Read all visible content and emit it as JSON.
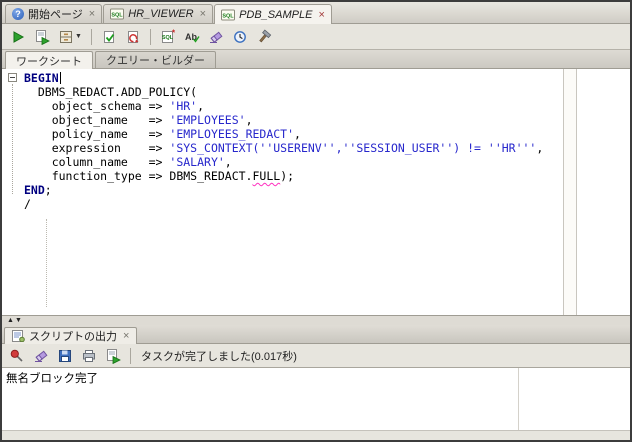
{
  "doc_tabs": [
    {
      "label": "開始ページ",
      "close": "×",
      "active": false
    },
    {
      "label": "HR_VIEWER",
      "close": "×",
      "active": false
    },
    {
      "label": "PDB_SAMPLE",
      "close": "×",
      "active": true
    }
  ],
  "icons": {
    "help_glyph": "?",
    "sql_badge": "SQL",
    "case_letters": "Ab",
    "asterisk": "*"
  },
  "main_toolbar": {
    "icon_names": [
      "run-statement",
      "run-script",
      "explain-plan",
      "commit",
      "rollback",
      "unshared-worksheet",
      "change-case",
      "clear",
      "sql-history",
      "hammer"
    ]
  },
  "worksheet_tabs": [
    {
      "label": "ワークシート",
      "active": true
    },
    {
      "label": "クエリー・ビルダー",
      "active": false
    }
  ],
  "editor": {
    "code_lines": [
      {
        "caret": true,
        "segments": [
          {
            "t": "BEGIN",
            "c": "kw"
          }
        ]
      },
      {
        "segments": [
          {
            "t": "  DBMS_REDACT.ADD_POLICY(",
            "c": "plain"
          }
        ]
      },
      {
        "segments": [
          {
            "t": "    object_schema => ",
            "c": "plain"
          },
          {
            "t": "'HR'",
            "c": "str"
          },
          {
            "t": ",",
            "c": "plain"
          }
        ]
      },
      {
        "segments": [
          {
            "t": "    object_name   => ",
            "c": "plain"
          },
          {
            "t": "'EMPLOYEES'",
            "c": "str"
          },
          {
            "t": ",",
            "c": "plain"
          }
        ]
      },
      {
        "segments": [
          {
            "t": "    policy_name   => ",
            "c": "plain"
          },
          {
            "t": "'EMPLOYEES_REDACT'",
            "c": "str"
          },
          {
            "t": ",",
            "c": "plain"
          }
        ]
      },
      {
        "segments": [
          {
            "t": "    expression    => ",
            "c": "plain"
          },
          {
            "t": "'SYS_CONTEXT(''USERENV'',''SESSION_USER'') != ''HR'''",
            "c": "str"
          },
          {
            "t": ",",
            "c": "plain"
          }
        ]
      },
      {
        "segments": [
          {
            "t": "    column_name   => ",
            "c": "plain"
          },
          {
            "t": "'SALARY'",
            "c": "str"
          },
          {
            "t": ",",
            "c": "plain"
          }
        ]
      },
      {
        "segments": [
          {
            "t": "    function_type => DBMS_REDACT.",
            "c": "plain"
          },
          {
            "t": "FULL",
            "c": "plain sq"
          },
          {
            "t": ");",
            "c": "plain"
          }
        ]
      },
      {
        "segments": [
          {
            "t": "END",
            "c": "kw"
          },
          {
            "t": ";",
            "c": "plain"
          }
        ]
      },
      {
        "segments": [
          {
            "t": "/",
            "c": "plain"
          }
        ]
      }
    ]
  },
  "splitter": {
    "up": "▲",
    "down": "▼"
  },
  "output_panel": {
    "tab_label": "スクリプトの出力",
    "tab_close": "×",
    "toolbar_icon_names": [
      "pin",
      "clear",
      "save",
      "print",
      "run-script"
    ],
    "status_text": "タスクが完了しました(0.017秒)",
    "output_text": "無名ブロック完了"
  },
  "colors": {
    "keyword": "#000080",
    "string": "#2727cc",
    "squiggle": "#ff2fbf",
    "run_green": "#2da12d"
  }
}
